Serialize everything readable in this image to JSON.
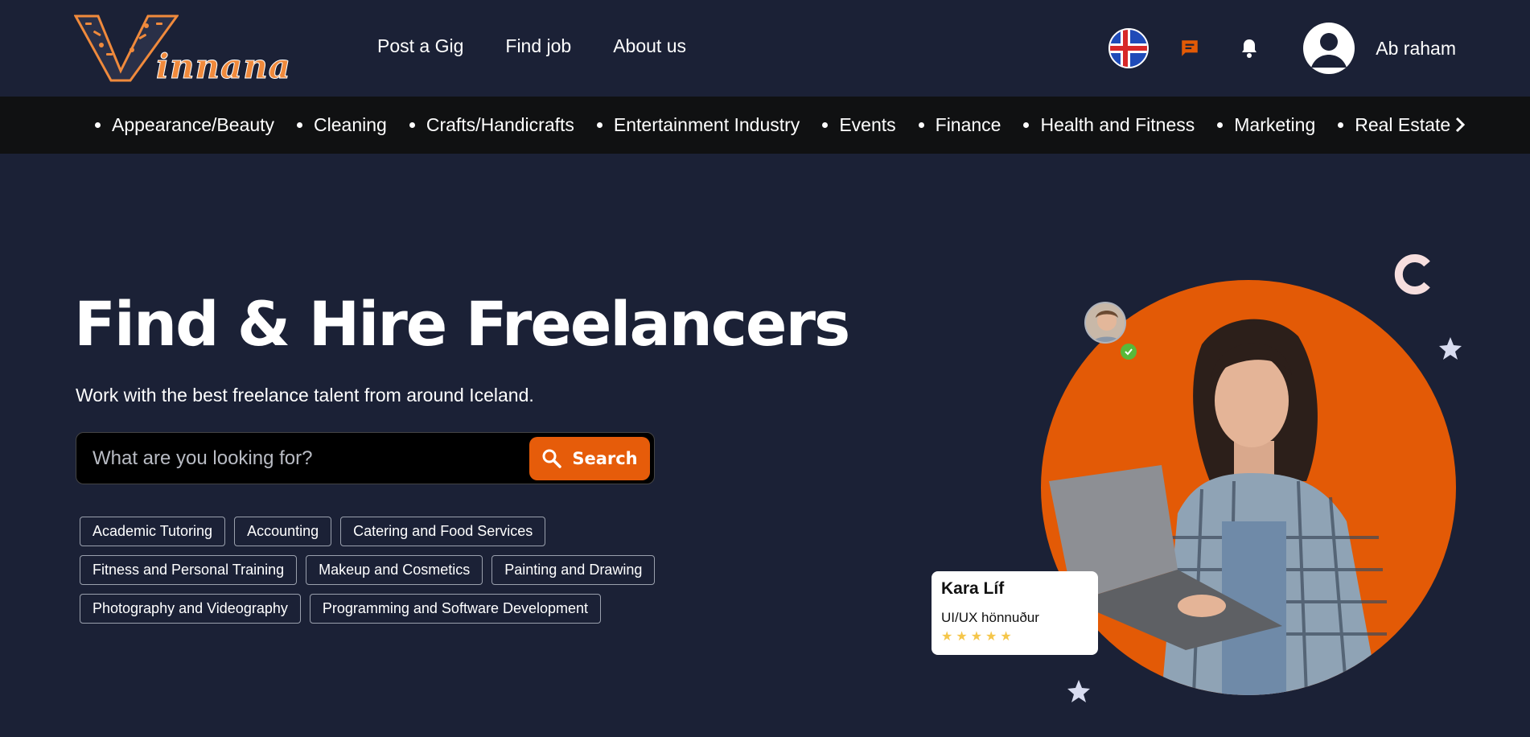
{
  "header": {
    "logo_text": "innana",
    "nav": [
      "Post a Gig",
      "Find job",
      "About us"
    ],
    "user_name": "Ab raham"
  },
  "categories": [
    "Appearance/Beauty",
    "Cleaning",
    "Crafts/Handicrafts",
    "Entertainment Industry",
    "Events",
    "Finance",
    "Health and Fitness",
    "Marketing",
    "Real Estate"
  ],
  "hero": {
    "title": "Find & Hire Freelancers",
    "subtitle": "Work with the best freelance talent from around Iceland.",
    "search_placeholder": "What are you looking for?",
    "search_button": "Search"
  },
  "popular_tags": [
    "Academic Tutoring",
    "Accounting",
    "Catering and Food Services",
    "Fitness and Personal Training",
    "Makeup and Cosmetics",
    "Painting and Drawing",
    "Photography and Videography",
    "Programming and Software Development"
  ],
  "profile_card": {
    "name": "Kara Líf",
    "role": "UI/UX hönnuður",
    "rating": 5
  },
  "colors": {
    "background": "#1b2136",
    "category_bar": "#101112",
    "accent": "#e35a06",
    "star": "#f5c64a",
    "verified": "#58b93a"
  },
  "icons": [
    "iceland-flag-icon",
    "chat-icon",
    "bell-icon",
    "user-icon",
    "chevron-right-icon",
    "search-icon",
    "check-icon",
    "star-icon"
  ]
}
